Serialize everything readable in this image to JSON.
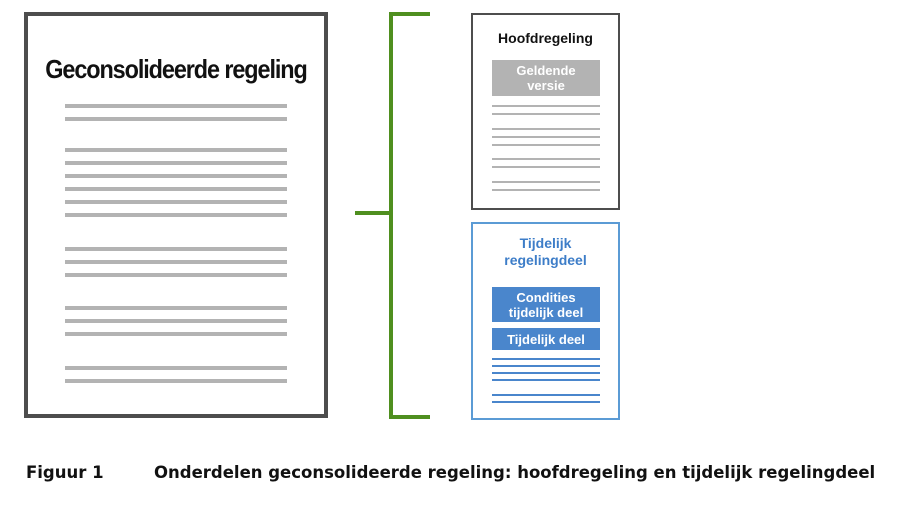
{
  "main_document": {
    "title": "Geconsolideerde regeling"
  },
  "hoofdregeling": {
    "title": "Hoofdregeling",
    "current_version_label": "Geldende\nversie"
  },
  "tijdelijk_regelingdeel": {
    "title": "Tijdelijk\nregelingdeel",
    "conditions_label": "Condities\ntijdelijk deel",
    "temporary_part_label": "Tijdelijk deel"
  },
  "caption": {
    "label": "Figuur 1",
    "text": "Onderdelen geconsolideerde regeling: hoofdregeling en tijdelijk regelingdeel"
  },
  "colors": {
    "bracket": "#4f8f1f",
    "blue_accent": "#4a86cc",
    "grey_text_lines": "#b3b3b3",
    "frame": "#4d4d4d"
  }
}
